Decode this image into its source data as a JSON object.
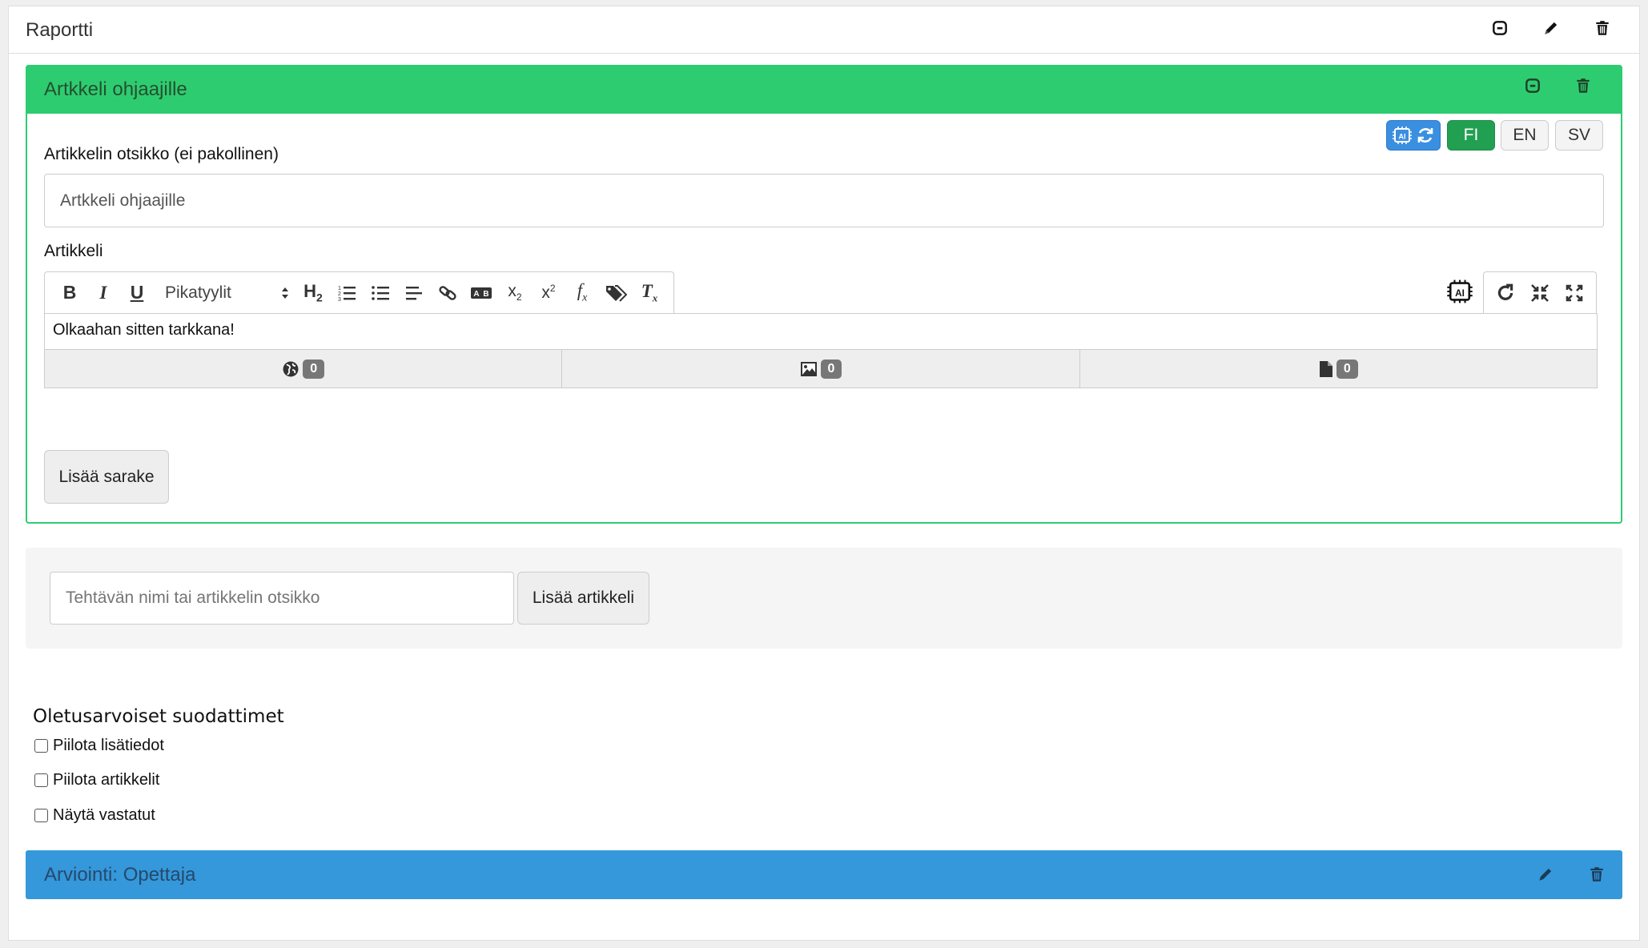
{
  "report": {
    "title": "Raportti"
  },
  "article_panel": {
    "title": "Artkkeli ohjaajille",
    "languages": [
      "FI",
      "EN",
      "SV"
    ],
    "ai_label": "AI",
    "title_field_label": "Artikkelin otsikko (ei pakollinen)",
    "title_field_value": "Artkkeli ohjaajille",
    "article_label": "Artikkeli",
    "styles_select": "Pikatyylit",
    "editor_content": "Olkaahan sitten tarkkana!",
    "attachments": [
      {
        "icon": "globe-icon",
        "count": "0"
      },
      {
        "icon": "image-icon",
        "count": "0"
      },
      {
        "icon": "file-icon",
        "count": "0"
      }
    ],
    "add_column_label": "Lisää sarake"
  },
  "new_article": {
    "placeholder": "Tehtävän nimi tai artikkelin otsikko",
    "add_button": "Lisää artikkeli"
  },
  "filters": {
    "title": "Oletusarvoiset suodattimet",
    "options": [
      "Piilota lisätiedot",
      "Piilota artikkelit",
      "Näytä vastatut"
    ]
  },
  "assessment_panel": {
    "title": "Arviointi: Opettaja"
  },
  "colors": {
    "article_header": "#2ecc71",
    "assessment_header": "#3498db",
    "lang_active": "#22a052",
    "ai_button": "#3a8fe0"
  }
}
